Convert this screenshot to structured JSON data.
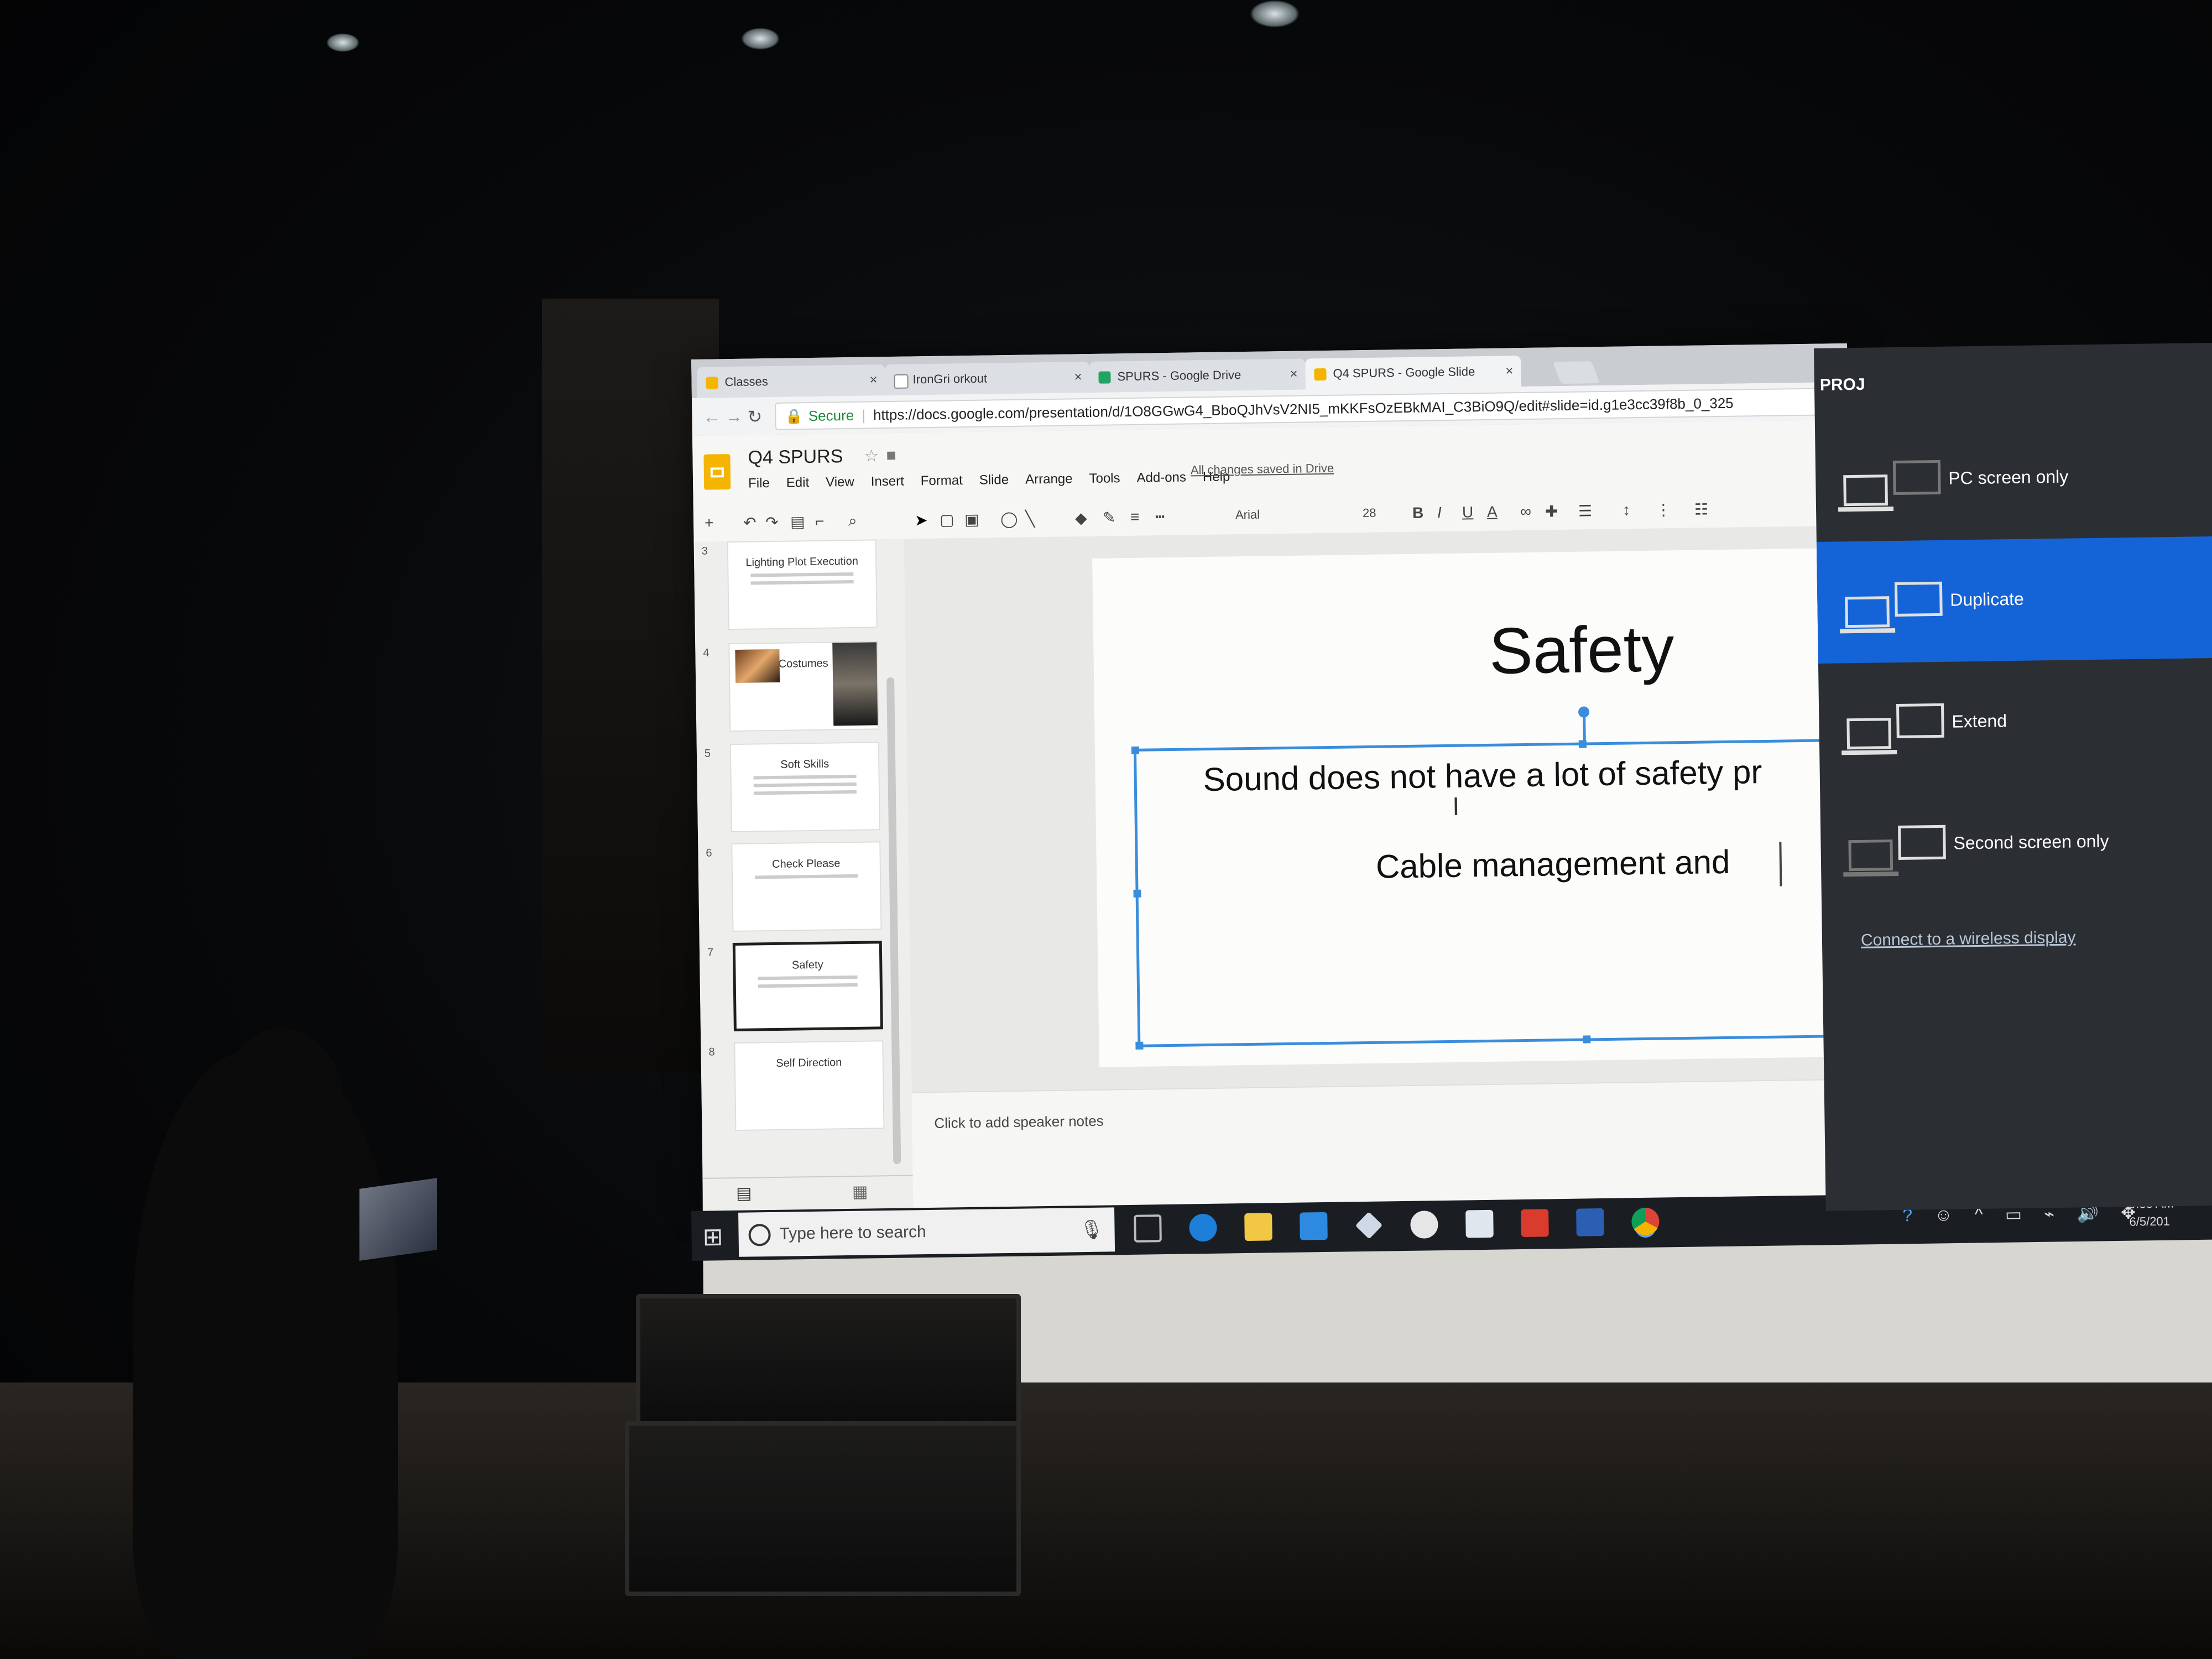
{
  "browser": {
    "tabs": [
      {
        "label": "Classes",
        "color": "#f4b400"
      },
      {
        "label": "IronGri    orkout",
        "color": "#bbbbbb"
      },
      {
        "label": "SPURS - Google Drive",
        "color": "#1fa463"
      },
      {
        "label": "Q4 SPURS - Google Slide",
        "color": "#f4b400",
        "active": true
      }
    ],
    "close_glyph": "×",
    "secure_label": "Secure",
    "url": "https://docs.google.com/presentation/d/1O8GGwG4_BboQJhVsV2NI5_mKKFsOzEBkMAI_C3BiO9Q/edit#slide=id.g1e3cc39f8b_0_325"
  },
  "app": {
    "doc_title": "Q4 SPURS",
    "menu": [
      "File",
      "Edit",
      "View",
      "Insert",
      "Format",
      "Slide",
      "Arrange",
      "Tools",
      "Add-ons",
      "Help"
    ],
    "save_status": "All changes saved in Drive",
    "toolbar": {
      "font": "Arial",
      "size": "28"
    }
  },
  "filmstrip": [
    {
      "num": "3",
      "title": "Lighting Plot Execution"
    },
    {
      "num": "4",
      "title": "Costumes"
    },
    {
      "num": "5",
      "title": "Soft Skills"
    },
    {
      "num": "6",
      "title": "Check Please"
    },
    {
      "num": "7",
      "title": "Safety",
      "selected": true
    },
    {
      "num": "8",
      "title": "Self Direction"
    }
  ],
  "slide": {
    "title": "Safety",
    "line1": "Sound does not have a lot of safety pr",
    "line2": "Cable management and"
  },
  "speaker_notes_placeholder": "Click to add speaker notes",
  "taskbar": {
    "search_placeholder": "Type here to search",
    "time": "9:38 AM",
    "date": "6/5/201",
    "icons": [
      "task-view",
      "edge",
      "file-explorer",
      "store",
      "dropbox",
      "amazon",
      "mail",
      "wps",
      "word",
      "chrome"
    ]
  },
  "project_panel": {
    "title": "PROJ",
    "options": [
      {
        "label": "PC screen only"
      },
      {
        "label": "Duplicate",
        "selected": true
      },
      {
        "label": "Extend"
      },
      {
        "label": "Second screen only"
      }
    ],
    "wireless_link": "Connect to a wireless display"
  },
  "colors": {
    "selection_blue": "#3a8ddc",
    "duplicate_highlight": "#1464d8",
    "slides_yellow": "#f4b400"
  }
}
